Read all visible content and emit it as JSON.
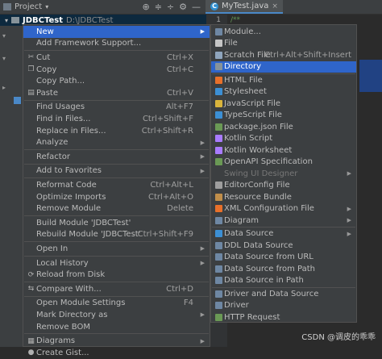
{
  "toolbar": {
    "title": "Project",
    "chevron": "▾",
    "tab_label": "MyTest.java",
    "tab_close": "×",
    "icons": [
      "target-icon",
      "collapse-icon",
      "expand-icon",
      "gear-icon",
      "minimize-icon"
    ],
    "glyphs": {
      "target": "⊕",
      "collapse": "≑",
      "expand": "÷",
      "gear": "⚙",
      "minimize": "—"
    }
  },
  "project": {
    "arrow": "▾",
    "name": "JDBCTest",
    "path": "D:\\JDBCTest"
  },
  "editor": {
    "line_number": "1",
    "code": "/**"
  },
  "context_menu": {
    "items": [
      {
        "label": "New",
        "icon": "",
        "shortcut": "",
        "submenu": true,
        "selected": true
      },
      {
        "label": "Add Framework Support...",
        "icon": "",
        "shortcut": "",
        "submenu": false
      },
      {
        "sep": true
      },
      {
        "label": "Cut",
        "icon": "scissors-icon",
        "glyph": "✂",
        "shortcut": "Ctrl+X"
      },
      {
        "label": "Copy",
        "icon": "copy-icon",
        "glyph": "❐",
        "shortcut": "Ctrl+C"
      },
      {
        "label": "Copy Path...",
        "icon": "",
        "shortcut": ""
      },
      {
        "label": "Paste",
        "icon": "paste-icon",
        "glyph": "▤",
        "shortcut": "Ctrl+V"
      },
      {
        "sep": true
      },
      {
        "label": "Find Usages",
        "shortcut": "Alt+F7"
      },
      {
        "label": "Find in Files...",
        "shortcut": "Ctrl+Shift+F"
      },
      {
        "label": "Replace in Files...",
        "shortcut": "Ctrl+Shift+R"
      },
      {
        "label": "Analyze",
        "shortcut": "",
        "submenu": true
      },
      {
        "sep": true
      },
      {
        "label": "Refactor",
        "shortcut": "",
        "submenu": true
      },
      {
        "sep": true
      },
      {
        "label": "Add to Favorites",
        "shortcut": "",
        "submenu": true
      },
      {
        "sep": true
      },
      {
        "label": "Reformat Code",
        "shortcut": "Ctrl+Alt+L"
      },
      {
        "label": "Optimize Imports",
        "shortcut": "Ctrl+Alt+O"
      },
      {
        "label": "Remove Module",
        "shortcut": "Delete"
      },
      {
        "sep": true
      },
      {
        "label": "Build Module 'JDBCTest'",
        "shortcut": ""
      },
      {
        "label": "Rebuild Module 'JDBCTest'",
        "shortcut": "Ctrl+Shift+F9"
      },
      {
        "sep": true
      },
      {
        "label": "Open In",
        "shortcut": "",
        "submenu": true
      },
      {
        "sep": true
      },
      {
        "label": "Local History",
        "shortcut": "",
        "submenu": true
      },
      {
        "label": "Reload from Disk",
        "icon": "reload-icon",
        "glyph": "⟳",
        "shortcut": ""
      },
      {
        "sep": true
      },
      {
        "label": "Compare With...",
        "icon": "compare-icon",
        "glyph": "⇆",
        "shortcut": "Ctrl+D"
      },
      {
        "sep": true
      },
      {
        "label": "Open Module Settings",
        "shortcut": "F4"
      },
      {
        "label": "Mark Directory as",
        "shortcut": "",
        "submenu": true
      },
      {
        "label": "Remove BOM",
        "shortcut": ""
      },
      {
        "sep": true
      },
      {
        "label": "Diagrams",
        "icon": "diagram-icon",
        "glyph": "▦",
        "shortcut": "",
        "submenu": true
      },
      {
        "label": "Create Gist...",
        "icon": "github-icon",
        "glyph": "●",
        "shortcut": ""
      }
    ]
  },
  "new_menu": {
    "items": [
      {
        "label": "Module...",
        "icon": "module-icon",
        "color": "#6e87a3",
        "shortcut": ""
      },
      {
        "label": "File",
        "icon": "file-icon",
        "color": "#c5c5c5",
        "shortcut": ""
      },
      {
        "label": "Scratch File",
        "icon": "scratch-file-icon",
        "color": "#8fa5bd",
        "shortcut": "Ctrl+Alt+Shift+Insert"
      },
      {
        "label": "Directory",
        "icon": "folder-icon",
        "color": "#87939a",
        "shortcut": "",
        "selected": true
      },
      {
        "sep": true
      },
      {
        "label": "HTML File",
        "icon": "html-icon",
        "color": "#e8702a",
        "shortcut": ""
      },
      {
        "label": "Stylesheet",
        "icon": "css-icon",
        "color": "#3c8fd4",
        "shortcut": ""
      },
      {
        "label": "JavaScript File",
        "icon": "js-icon",
        "color": "#d9b43c",
        "shortcut": ""
      },
      {
        "label": "TypeScript File",
        "icon": "ts-icon",
        "color": "#3c8fd4",
        "shortcut": ""
      },
      {
        "label": "package.json File",
        "icon": "npm-icon",
        "color": "#6a9955",
        "shortcut": ""
      },
      {
        "label": "Kotlin Script",
        "icon": "kotlin-icon",
        "color": "#a97bff",
        "shortcut": ""
      },
      {
        "label": "Kotlin Worksheet",
        "icon": "kotlin-worksheet-icon",
        "color": "#a97bff",
        "shortcut": ""
      },
      {
        "label": "OpenAPI Specification",
        "icon": "openapi-icon",
        "color": "#6a9955",
        "shortcut": ""
      },
      {
        "label": "Swing UI Designer",
        "icon": "",
        "color": "",
        "shortcut": "",
        "submenu": true,
        "disabled": true
      },
      {
        "label": "EditorConfig File",
        "icon": "editorconfig-icon",
        "color": "#9e9e9e",
        "shortcut": ""
      },
      {
        "label": "Resource Bundle",
        "icon": "resource-bundle-icon",
        "color": "#c08e4a",
        "shortcut": ""
      },
      {
        "label": "XML Configuration File",
        "icon": "xml-icon",
        "color": "#e8702a",
        "shortcut": "",
        "submenu": true
      },
      {
        "label": "Diagram",
        "icon": "diagram-icon",
        "color": "#6e87a3",
        "shortcut": "",
        "submenu": true
      },
      {
        "sep": true
      },
      {
        "label": "Data Source",
        "icon": "data-source-icon",
        "color": "#3c8fd4",
        "shortcut": "",
        "submenu": true
      },
      {
        "label": "DDL Data Source",
        "icon": "ddl-icon",
        "color": "#6e87a3",
        "shortcut": ""
      },
      {
        "label": "Data Source from URL",
        "icon": "url-data-source-icon",
        "color": "#6e87a3",
        "shortcut": ""
      },
      {
        "label": "Data Source from Path",
        "icon": "path-data-source-icon",
        "color": "#6e87a3",
        "shortcut": ""
      },
      {
        "label": "Data Source in Path",
        "icon": "in-path-data-source-icon",
        "color": "#6e87a3",
        "shortcut": ""
      },
      {
        "sep": true
      },
      {
        "label": "Driver and Data Source",
        "icon": "driver-data-source-icon",
        "color": "#6e87a3",
        "shortcut": ""
      },
      {
        "label": "Driver",
        "icon": "driver-icon",
        "color": "#6e87a3",
        "shortcut": ""
      },
      {
        "label": "HTTP Request",
        "icon": "http-request-icon",
        "color": "#6a9955",
        "shortcut": ""
      }
    ]
  },
  "watermark": "CSDN @调皮的乖乖"
}
